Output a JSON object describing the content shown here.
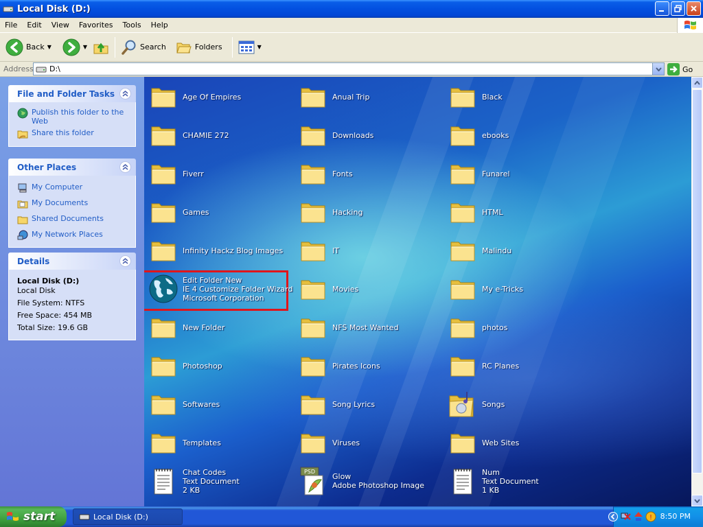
{
  "window": {
    "title": "Local Disk (D:)"
  },
  "menu": [
    "File",
    "Edit",
    "View",
    "Favorites",
    "Tools",
    "Help"
  ],
  "toolbar": {
    "back": "Back",
    "search": "Search",
    "folders": "Folders"
  },
  "address": {
    "label": "Address",
    "value": "D:\\",
    "go": "Go"
  },
  "left_pane": {
    "file_tasks": {
      "title": "File and Folder Tasks",
      "items": [
        "Publish this folder to the Web",
        "Share this folder"
      ]
    },
    "other_places": {
      "title": "Other Places",
      "items": [
        "My Computer",
        "My Documents",
        "Shared Documents",
        "My Network Places"
      ]
    },
    "details": {
      "title": "Details",
      "name": "Local Disk (D:)",
      "type": "Local Disk",
      "file_system": "File System: NTFS",
      "free_space": "Free Space: 454 MB",
      "total_size": "Total Size: 19.6 GB"
    }
  },
  "items": [
    {
      "name": "Age Of Empires"
    },
    {
      "name": "Anual Trip"
    },
    {
      "name": "Black"
    },
    {
      "name": "CHAMIE 272"
    },
    {
      "name": "Downloads"
    },
    {
      "name": "ebooks"
    },
    {
      "name": "Fiverr"
    },
    {
      "name": "Fonts"
    },
    {
      "name": "Funarel"
    },
    {
      "name": "Games"
    },
    {
      "name": "Hacking"
    },
    {
      "name": "HTML"
    },
    {
      "name": "Infinity Hackz Blog Images"
    },
    {
      "name": "IT"
    },
    {
      "name": "Malindu"
    },
    {
      "name": "Edit Folder New",
      "line2": "IE 4 Customize Folder Wizard",
      "line3": "Microsoft Corporation"
    },
    {
      "name": "Movies"
    },
    {
      "name": "My e-Tricks"
    },
    {
      "name": "New Folder"
    },
    {
      "name": "NFS Most Wanted"
    },
    {
      "name": "photos"
    },
    {
      "name": "Photoshop"
    },
    {
      "name": "Pirates Icons"
    },
    {
      "name": "RC Planes"
    },
    {
      "name": "Softwares"
    },
    {
      "name": "Song Lyrics"
    },
    {
      "name": "Songs"
    },
    {
      "name": "Templates"
    },
    {
      "name": "Viruses"
    },
    {
      "name": "Web Sites"
    },
    {
      "name": "Chat Codes",
      "line2": "Text Document",
      "line3": "2 KB"
    },
    {
      "name": "Glow",
      "line2": "Adobe Photoshop Image"
    },
    {
      "name": "Num",
      "line2": "Text Document",
      "line3": "1 KB"
    }
  ],
  "icons": {
    "psd_badge": "PSD"
  },
  "taskbar": {
    "start": "start",
    "task": "Local Disk (D:)",
    "clock": "8:50 PM"
  }
}
